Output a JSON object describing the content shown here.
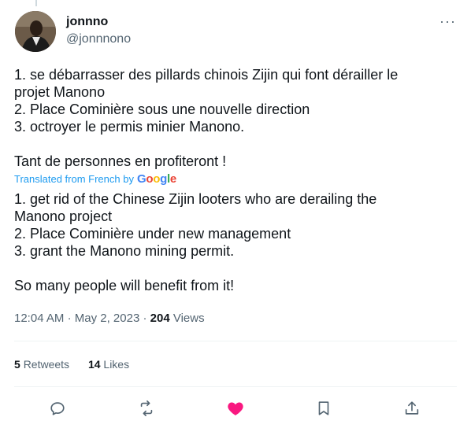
{
  "user": {
    "name": "jonnno",
    "handle": "@jonnnono"
  },
  "tweet": {
    "text": "1. se débarrasser des pillards chinois Zijin qui font dérailler le\nprojet Manono\n2. Place Cominière sous une nouvelle direction\n3. octroyer le permis minier Manono.\n\nTant de personnes en profiteront !",
    "translated_label": "Translated from French by",
    "translator": "Google",
    "translation": "1. get rid of the Chinese Zijin looters who are derailing the\nManono project\n2. Place Cominière under new management\n3. grant the Manono mining permit.\n\nSo many people will benefit from it!"
  },
  "meta": {
    "time": "12:04 AM",
    "date": "May 2, 2023",
    "views_count": "204",
    "views_label": "Views"
  },
  "stats": {
    "retweets_count": "5",
    "retweets_label": "Retweets",
    "likes_count": "14",
    "likes_label": "Likes"
  },
  "actions": {
    "reply_icon": "reply-icon",
    "retweet_icon": "retweet-icon",
    "like_icon": "heart-filled-icon",
    "bookmark_icon": "bookmark-icon",
    "share_icon": "share-icon"
  },
  "colors": {
    "accent": "#1d9bf0",
    "like": "#f91880",
    "muted": "#536471"
  }
}
